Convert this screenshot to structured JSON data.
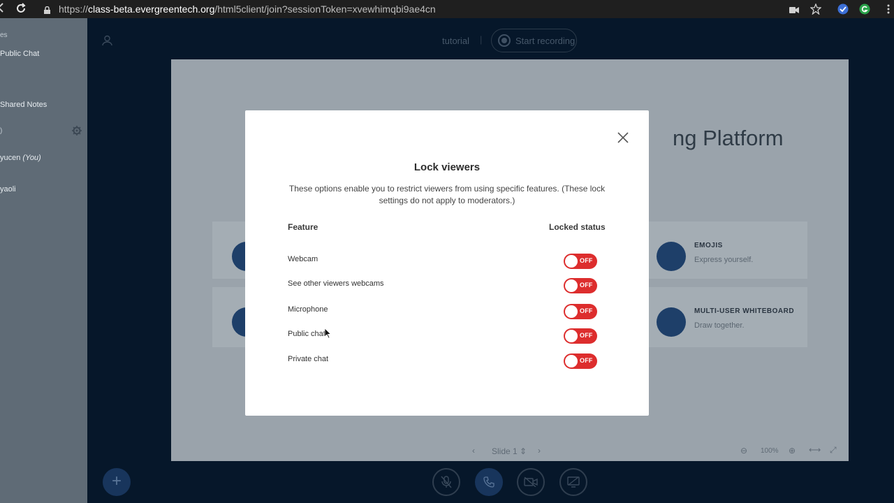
{
  "browser": {
    "url_scheme": "https://",
    "url_host": "class-beta.evergreentech.org",
    "url_path": "/html5client/join?sessionToken=xvewhimqbi9ae4cn"
  },
  "sidebar": {
    "messages_header": "es",
    "public_chat": "Public Chat",
    "shared_notes": "Shared Notes",
    "users_header": ")",
    "user_self_name": "yucen",
    "user_self_tag": "(You)",
    "user_other": "yaoli"
  },
  "header": {
    "meeting_name": "tutorial",
    "record_label": "Start recording"
  },
  "slide": {
    "title_partial": "ng Platform",
    "features": [
      {
        "head": "EMOJIS",
        "sub": "Express yourself."
      },
      {
        "head": "MULTI-USER WHITEBOARD",
        "sub": "Draw together."
      }
    ],
    "slide_label": "Slide 1",
    "zoom": "100%"
  },
  "modal": {
    "title": "Lock viewers",
    "description": "These options enable you to restrict viewers from using specific features. (These lock settings do not apply to moderators.)",
    "col_feature": "Feature",
    "col_status": "Locked status",
    "rows": [
      {
        "label": "Webcam",
        "state": "OFF"
      },
      {
        "label": "See other viewers webcams",
        "state": "OFF"
      },
      {
        "label": "Microphone",
        "state": "OFF"
      },
      {
        "label": "Public chat",
        "state": "OFF"
      },
      {
        "label": "Private chat",
        "state": "OFF"
      }
    ]
  },
  "colors": {
    "toggle_off": "#dd2d2d",
    "modal_bg": "#ffffff",
    "page_bg": "#06172a"
  }
}
